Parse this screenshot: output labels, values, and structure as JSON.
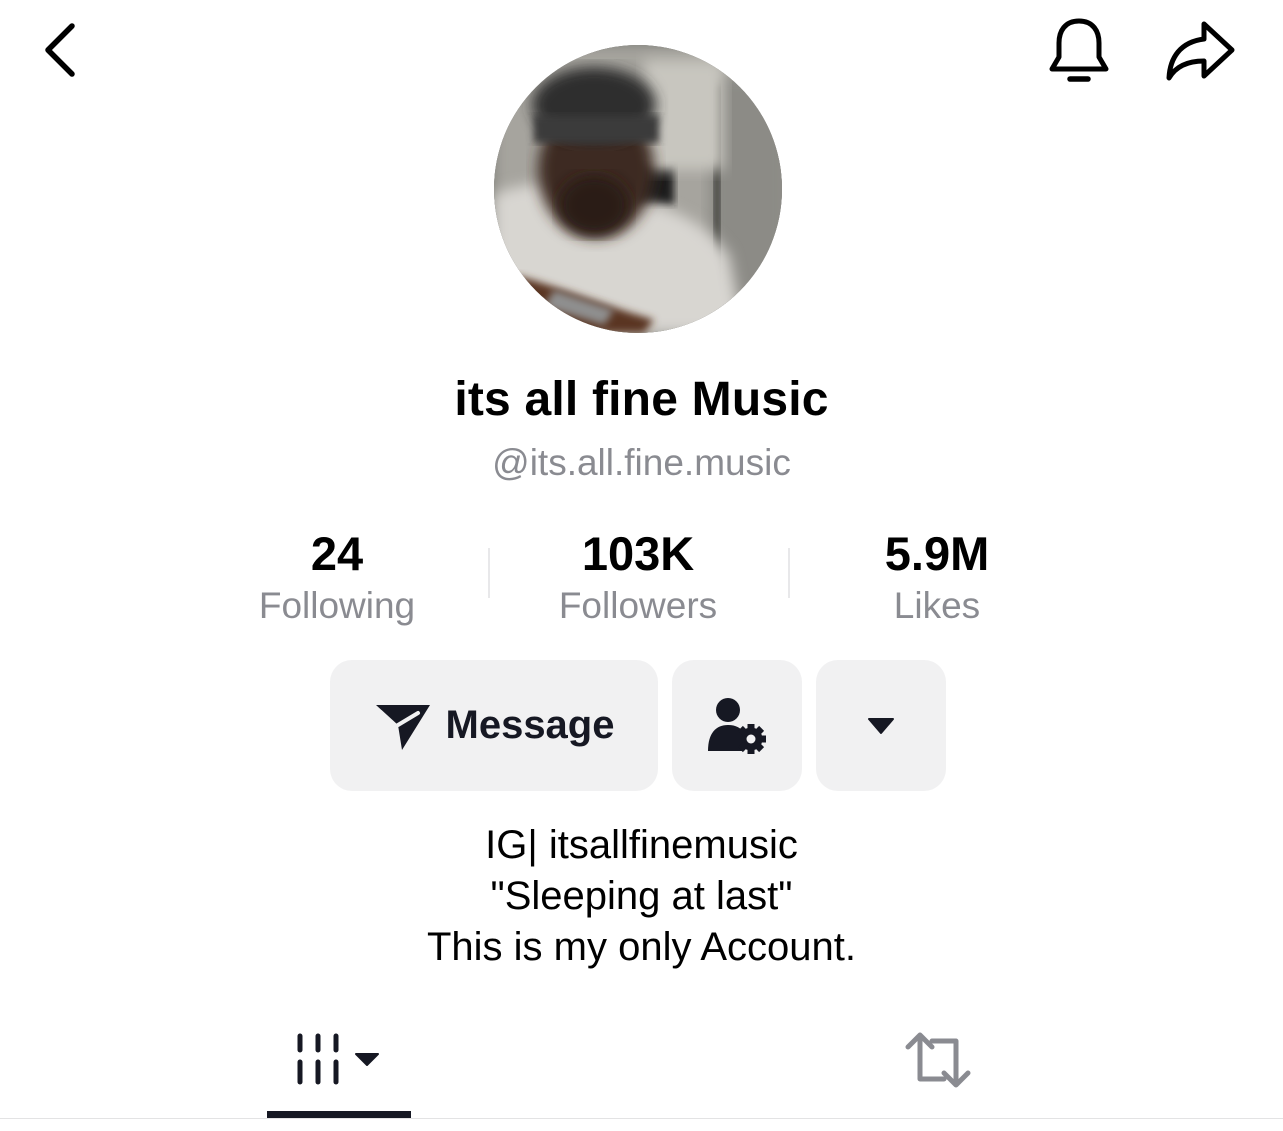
{
  "profile": {
    "display_name": "its all fine Music",
    "handle": "@its.all.fine.music"
  },
  "stats": {
    "following": {
      "value": "24",
      "label": "Following"
    },
    "followers": {
      "value": "103K",
      "label": "Followers"
    },
    "likes": {
      "value": "5.9M",
      "label": "Likes"
    }
  },
  "actions": {
    "message_label": "Message"
  },
  "bio": {
    "lines": [
      "IG| itsallfinemusic",
      "\"Sleeping at last\"",
      "This is my only Account."
    ]
  },
  "icons": {
    "back": "chevron-left-icon",
    "bell": "bell-icon",
    "share": "share-arrow-icon",
    "message": "send-plane-icon",
    "friends": "person-settings-icon",
    "more": "caret-down-icon",
    "videos_tab": "grid-bars-icon",
    "reposts_tab": "repost-icon"
  },
  "colors": {
    "text_primary": "#161823",
    "text_secondary": "#8a8b91",
    "button_bg": "#f1f1f2",
    "reposts_icon": "#8a8b91"
  }
}
